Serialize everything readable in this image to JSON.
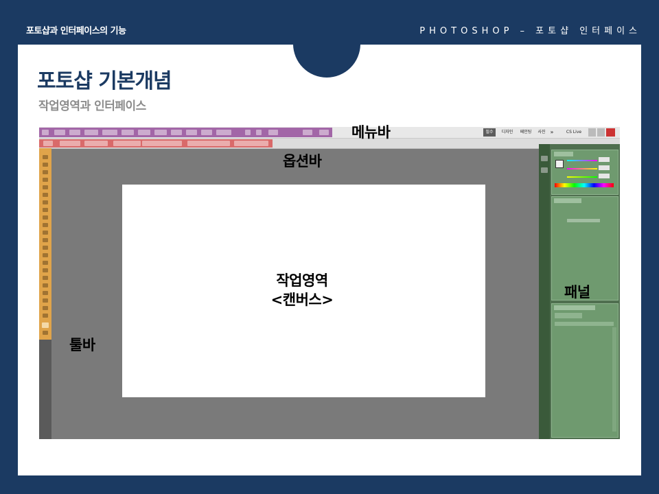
{
  "header": {
    "left": "포토샵과 인터페이스의 기능",
    "right": "PHOTOSHOP – 포토샵 인터페이스"
  },
  "slide": {
    "title": "포토샵 기본개념",
    "subtitle": "작업영역과 인터페이스"
  },
  "screenshot": {
    "labels": {
      "menubar": "메뉴바",
      "optionbar": "옵션바",
      "workarea_line1": "작업영역",
      "workarea_line2": "<캔버스>",
      "panel": "패널",
      "toolbar": "툴바"
    },
    "workspace_buttons": [
      "필수",
      "디자인",
      "페인팅",
      "사진",
      "»",
      "CS Live"
    ],
    "highlight_colors": {
      "menubar": "#a266a7",
      "optionbar": "#d96a6a",
      "toolbar": "#e0a44a",
      "panel": "#6f9a6f"
    }
  }
}
